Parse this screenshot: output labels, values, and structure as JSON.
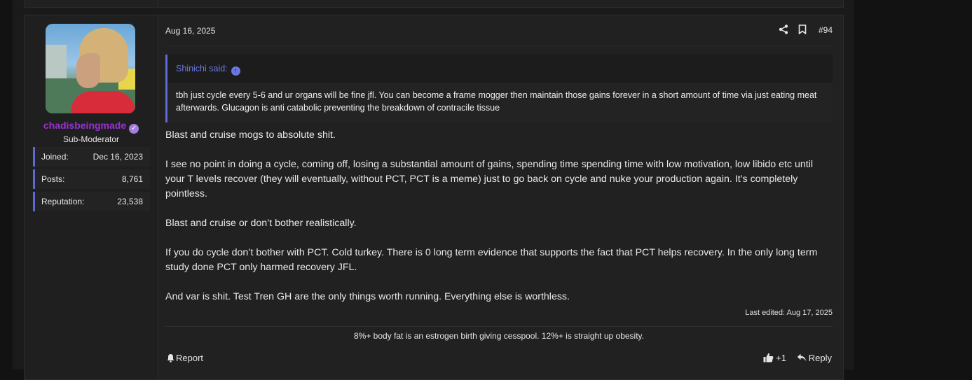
{
  "post": {
    "date": "Aug 16, 2025",
    "number": "#94",
    "last_edited": "Last edited: Aug 17, 2025"
  },
  "user": {
    "name": "chadisbeingmade",
    "title": "Sub-Moderator",
    "stats": [
      {
        "label": "Joined:",
        "value": "Dec 16, 2023"
      },
      {
        "label": "Posts:",
        "value": "8,761"
      },
      {
        "label": "Reputation:",
        "value": "23,538"
      }
    ]
  },
  "quote": {
    "author": "Shinichi said:",
    "text": "tbh just cycle every 5-6 and ur organs will be fine jfl. You can become a frame mogger then maintain those gains forever in a short amount of time via just eating meat afterwards. Glucagon is anti catabolic preventing the breakdown of contracile tissue"
  },
  "message": {
    "paragraphs": [
      "Blast and cruise mogs to absolute shit.",
      "I see no point in doing a cycle, coming off, losing a substantial amount of gains, spending time spending time with low motivation, low libido etc until your T levels recover (they will eventually, without PCT, PCT is a meme) just to go back on cycle and nuke your production again. It’s completely pointless.",
      "Blast and cruise or don’t bother realistically.",
      "If you do cycle don’t bother with PCT. Cold turkey. There is 0 long term evidence that supports the fact that PCT helps recovery. In the only long term study done PCT only harmed recovery JFL.",
      "And var is shit. Test Tren GH are the only things worth running. Everything else is worthless."
    ]
  },
  "signature": "8%+ body fat is an estrogen birth giving cesspool. 12%+ is straight up obesity.",
  "footer": {
    "report_label": "Report",
    "like_count": "+1",
    "reply_label": "Reply"
  },
  "icons": {
    "verified": "verified-badge-icon",
    "share": "share-icon",
    "bookmark": "bookmark-icon",
    "quote_jump": "arrow-up-circle-icon",
    "report": "bell-icon",
    "like": "thumbs-up-icon",
    "reply": "reply-arrow-icon"
  },
  "colors": {
    "accent": "#5d6ad6",
    "username": "#9b2fd6",
    "background": "#212121"
  }
}
